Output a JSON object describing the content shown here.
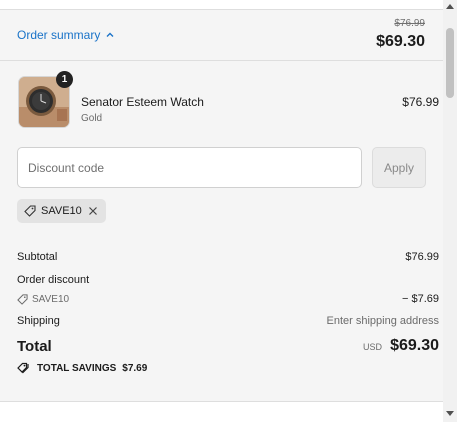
{
  "summary_header": {
    "toggle_label": "Order summary",
    "original_price": "$76.99",
    "total": "$69.30"
  },
  "product": {
    "quantity": "1",
    "name": "Senator Esteem Watch",
    "variant": "Gold",
    "price": "$76.99"
  },
  "discount": {
    "placeholder": "Discount code",
    "apply_label": "Apply",
    "applied_code": "SAVE10"
  },
  "totals": {
    "subtotal_label": "Subtotal",
    "subtotal_value": "$76.99",
    "order_discount_label": "Order discount",
    "discount_code": "SAVE10",
    "discount_value": "− $7.69",
    "shipping_label": "Shipping",
    "shipping_value": "Enter shipping address",
    "total_label": "Total",
    "currency": "USD",
    "total_value": "$69.30",
    "savings_label": "TOTAL SAVINGS",
    "savings_value": "$7.69"
  },
  "colors": {
    "link": "#1a73c8",
    "panel_bg": "#f5f5f5",
    "badge_bg": "#222222"
  },
  "icons": [
    "chevron-up-icon",
    "tag-icon",
    "close-icon",
    "savings-tag-icon"
  ]
}
